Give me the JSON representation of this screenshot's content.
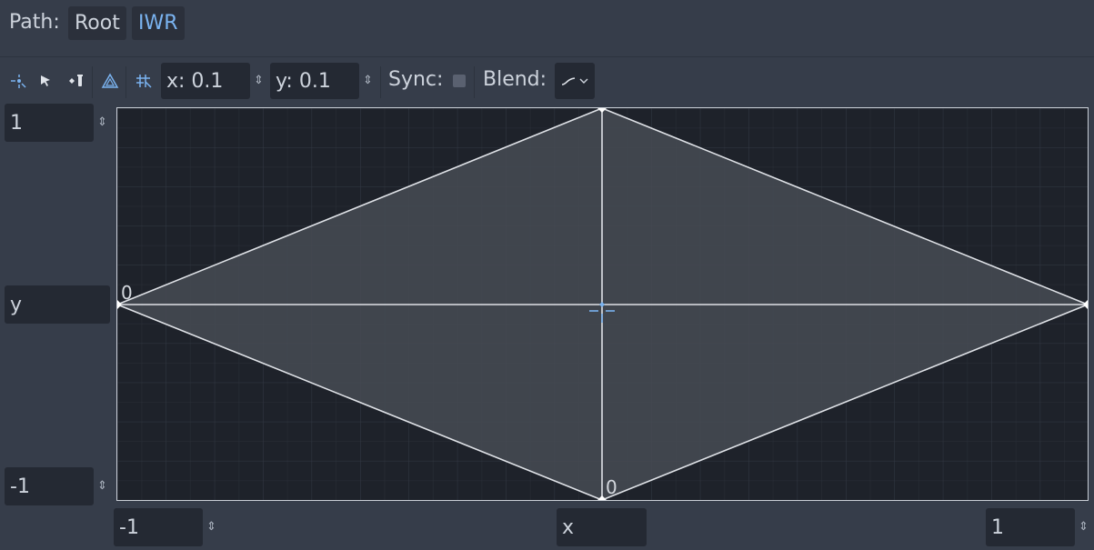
{
  "path": {
    "label": "Path:",
    "crumbs": [
      {
        "label": "Root"
      },
      {
        "label": "IWR"
      }
    ]
  },
  "toolbar": {
    "tools": [
      {
        "icon": "create-point-icon"
      },
      {
        "icon": "select-arrow-icon"
      },
      {
        "icon": "erase-point-icon"
      },
      {
        "icon": "snap-triangle-icon"
      },
      {
        "icon": "grid-snap-icon"
      }
    ],
    "snap_x": "x: 0.1",
    "snap_y": "y: 0.1",
    "sync_label": "Sync:",
    "sync_checked": false,
    "blend_label": "Blend:",
    "blend_value_icon": "blend-curve-icon"
  },
  "blend_space": {
    "y_max": "1",
    "y_label": "y",
    "y_min": "-1",
    "x_min": "-1",
    "x_label": "x",
    "x_max": "1",
    "point_labels": {
      "left": "0",
      "bottom": "0"
    }
  },
  "colors": {
    "background": "#363d4a",
    "canvas": "#1e222a",
    "accent": "#7ab3f0",
    "lines": "#d9dde3"
  }
}
